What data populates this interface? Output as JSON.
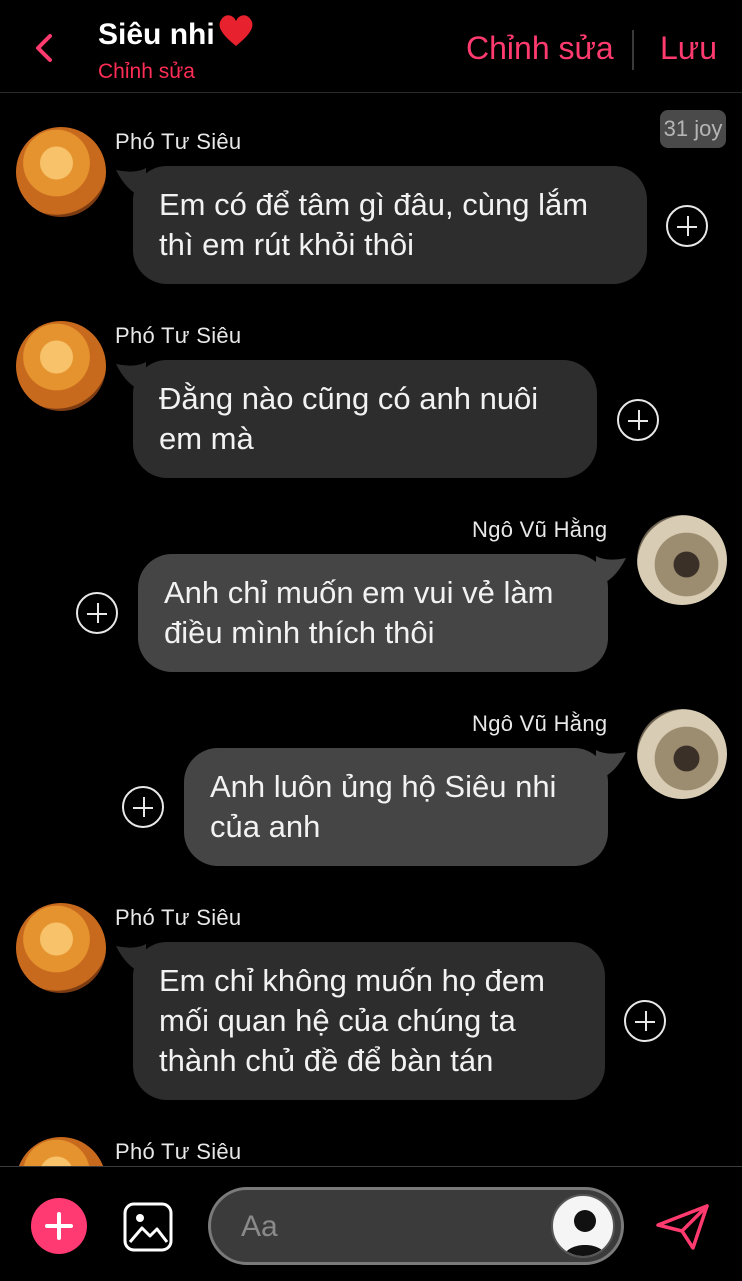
{
  "header": {
    "title": "Siêu nhi",
    "subtitle": "Chỉnh sửa",
    "edit_label": "Chỉnh sửa",
    "save_label": "Lưu"
  },
  "badge": "31 joy",
  "messages": [
    {
      "sender": "Phó Tư Siêu",
      "side": "left",
      "text": "Em có để tâm gì đâu, cùng lắm thì em rút khỏi  thôi"
    },
    {
      "sender": "Phó Tư Siêu",
      "side": "left",
      "text": "Đằng nào cũng có anh nuôi em mà"
    },
    {
      "sender": "Ngô Vũ Hằng",
      "side": "right",
      "text": "Anh chỉ muốn em vui vẻ làm điều mình thích thôi"
    },
    {
      "sender": "Ngô Vũ Hằng",
      "side": "right",
      "text": "Anh luôn ủng hộ Siêu nhi của anh"
    },
    {
      "sender": "Phó Tư Siêu",
      "side": "left",
      "text": "Em chỉ không muốn họ đem mối quan hệ của chúng ta thành chủ đề để bàn tán"
    },
    {
      "sender": "Phó Tư Siêu",
      "side": "left",
      "text": ""
    }
  ],
  "composer": {
    "placeholder": "Aa"
  },
  "colors": {
    "accent": "#ff3a6e",
    "bubble_left": "#2d2d2d",
    "bubble_right": "#454545"
  }
}
